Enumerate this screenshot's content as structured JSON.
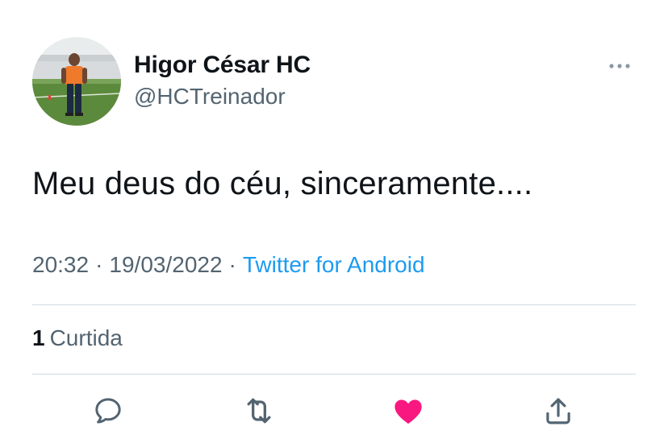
{
  "user": {
    "name": "Higor César HC",
    "handle": "@HCTreinador"
  },
  "tweet": {
    "text": "Meu deus do céu, sinceramente....",
    "time": "20:32",
    "separator": "·",
    "date": "19/03/2022",
    "source": "Twitter for Android"
  },
  "stats": {
    "likes_count": "1",
    "likes_label": "Curtida"
  },
  "actions": {
    "reply_icon": "reply-icon",
    "retweet_icon": "retweet-icon",
    "like_icon": "heart-icon",
    "like_active": true,
    "share_icon": "share-icon"
  },
  "colors": {
    "text": "#0f1419",
    "secondary": "#536471",
    "link": "#1d9bf0",
    "like": "#f91880",
    "divider": "#cfd9de"
  }
}
